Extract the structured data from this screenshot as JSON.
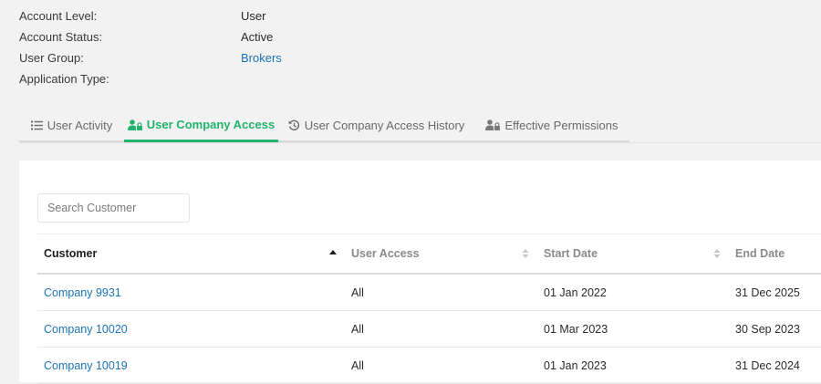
{
  "account": {
    "fields": [
      {
        "label": "Account Level:",
        "value": "User",
        "is_link": false
      },
      {
        "label": "Account Status:",
        "value": "Active",
        "is_link": false
      },
      {
        "label": "User Group:",
        "value": "Brokers",
        "is_link": true
      },
      {
        "label": "Application Type:",
        "value": "",
        "is_link": false
      }
    ]
  },
  "tabs": [
    {
      "label": "User Activity",
      "icon": "list-icon",
      "active": false
    },
    {
      "label": "User Company Access",
      "icon": "users-lock-icon",
      "active": true
    },
    {
      "label": "User Company Access History",
      "icon": "history-icon",
      "active": false
    },
    {
      "label": "Effective Permissions",
      "icon": "users-lock-icon",
      "active": false
    }
  ],
  "search": {
    "placeholder": "Search Customer",
    "value": ""
  },
  "table": {
    "columns": [
      {
        "label": "Customer",
        "sort": "ascending"
      },
      {
        "label": "User Access",
        "sort": "none"
      },
      {
        "label": "Start Date",
        "sort": "none"
      },
      {
        "label": "End Date",
        "sort": "none"
      }
    ],
    "rows": [
      {
        "customer": "Company 9931",
        "access": "All",
        "start": "01 Jan 2022",
        "end": "31 Dec 2025"
      },
      {
        "customer": "Company 10020",
        "access": "All",
        "start": "01 Mar 2023",
        "end": "30 Sep 2023"
      },
      {
        "customer": "Company 10019",
        "access": "All",
        "start": "01 Jan 2023",
        "end": "31 Dec 2024"
      }
    ]
  },
  "colors": {
    "accent": "#21b36c",
    "link": "#1a73b8",
    "background": "#f2f2f2",
    "card": "#ffffff"
  }
}
